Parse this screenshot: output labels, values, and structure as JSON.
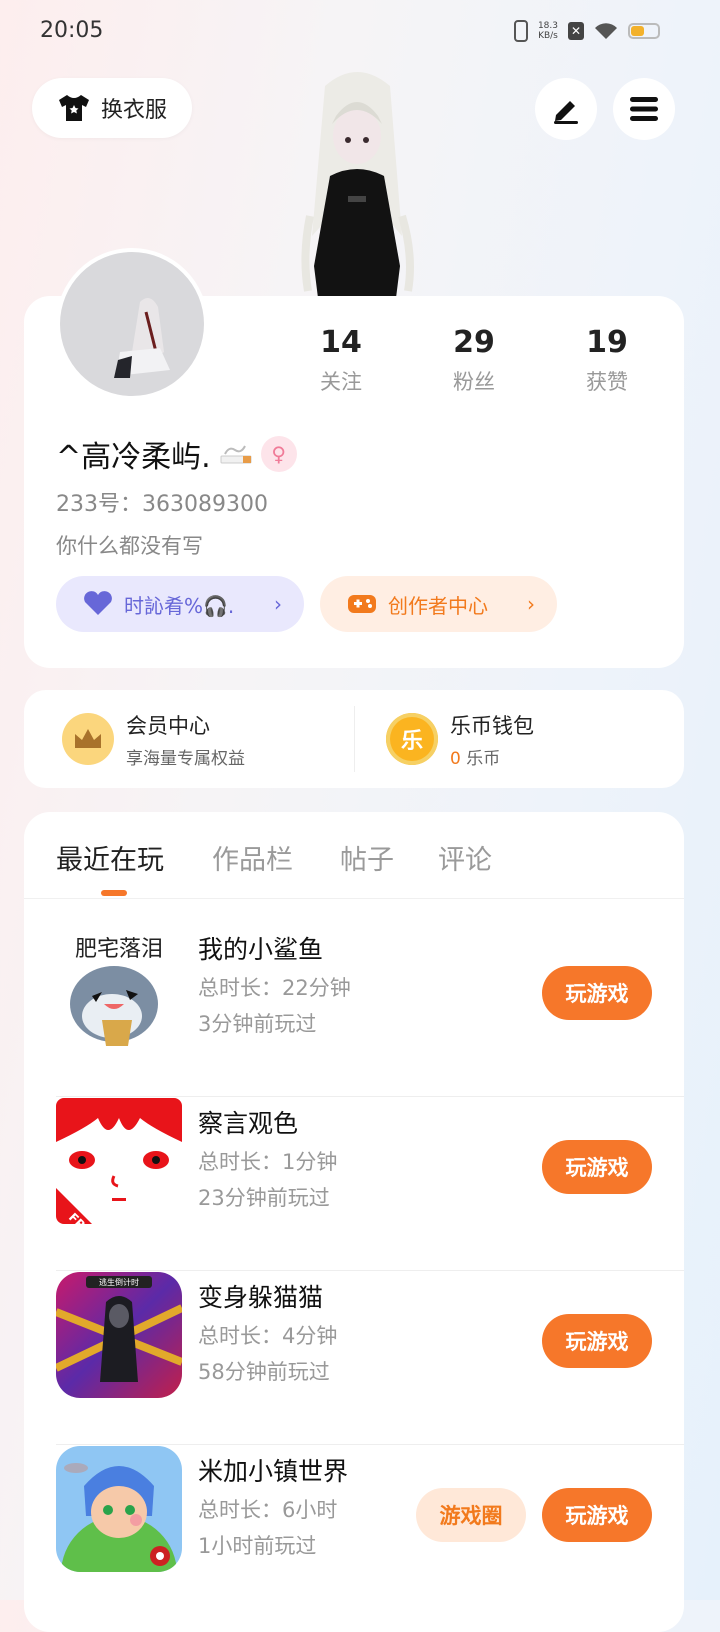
{
  "status_bar": {
    "time": "20:05",
    "net_speed_value": "18.3",
    "net_speed_unit": "KB/s",
    "battery_level": 0.45
  },
  "header": {
    "change_clothes_label": "换衣服"
  },
  "profile": {
    "stats": [
      {
        "value": "14",
        "label": "关注"
      },
      {
        "value": "29",
        "label": "粉丝"
      },
      {
        "value": "19",
        "label": "获赞"
      }
    ],
    "nickname": "^高冷柔屿.",
    "gender_symbol": "♀",
    "uid_text": "233号：363089300",
    "bio": "你什么都没有写",
    "pill_left_label": "时訫肴%🎧.",
    "pill_right_label": "创作者中心"
  },
  "wallet": {
    "member_title": "会员中心",
    "member_sub": "享海量专属权益",
    "coin_title": "乐币钱包",
    "coin_amount": "0",
    "coin_unit": "乐币",
    "coin_icon_char": "乐"
  },
  "tabs": [
    "最近在玩",
    "作品栏",
    "帖子",
    "评论"
  ],
  "games": [
    {
      "name": "我的小鲨鱼",
      "duration": "总时长：22分钟",
      "last_played": "3分钟前玩过",
      "play_label": "玩游戏",
      "thumb_text": "肥宅落泪"
    },
    {
      "name": "察言观色",
      "duration": "总时长：1分钟",
      "last_played": "23分钟前玩过",
      "play_label": "玩游戏",
      "thumb_text": "FREE"
    },
    {
      "name": "变身躲猫猫",
      "duration": "总时长：4分钟",
      "last_played": "58分钟前玩过",
      "play_label": "玩游戏",
      "thumb_text": "逃生倒计时"
    },
    {
      "name": "米加小镇世界",
      "duration": "总时长：6小时",
      "last_played": "1小时前玩过",
      "play_label": "玩游戏",
      "circle_label": "游戏圈"
    }
  ],
  "colors": {
    "accent": "#f6772a",
    "purple": "#6767d8"
  }
}
